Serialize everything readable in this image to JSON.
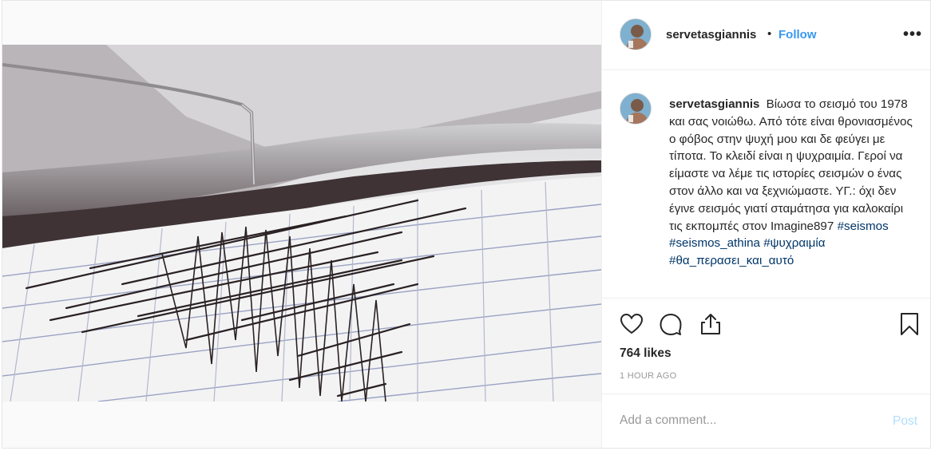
{
  "post": {
    "username": "servetasgiannis",
    "dot": "•",
    "follow_label": "Follow",
    "more_label": "•••"
  },
  "caption": {
    "username": "servetasgiannis",
    "text": "Βίωσα το σεισμό του 1978 και σας νοιώθω. Από τότε είναι θρονιασμένος ο φόβος στην ψυχή μου και δε φεύγει με τίποτα. Το κλειδί είναι η ψυχραιμία. Γεροί να είμαστε να λέμε τις ιστορίες σεισμών ο ένας στον άλλο και να ξεχνιώμαστε. ΥΓ.: όχι δεν έγινε σεισμός γιατί σταμάτησα για καλοκαίρι τις εκπομπές στον Imagine897",
    "hashtags": [
      "#seismos",
      "#seismos_athina",
      "#ψυχραιμία",
      "#θα_περασει_και_αυτό"
    ]
  },
  "icons": {
    "like": "heart-icon",
    "comment": "comment-icon",
    "share": "share-icon",
    "save": "bookmark-icon"
  },
  "stats": {
    "likes": "764 likes",
    "time": "1 HOUR AGO"
  },
  "comment_box": {
    "placeholder": "Add a comment...",
    "post_label": "Post"
  },
  "colors": {
    "link": "#3897f0",
    "hashtag": "#003569",
    "post_disabled": "#b2dffc"
  }
}
